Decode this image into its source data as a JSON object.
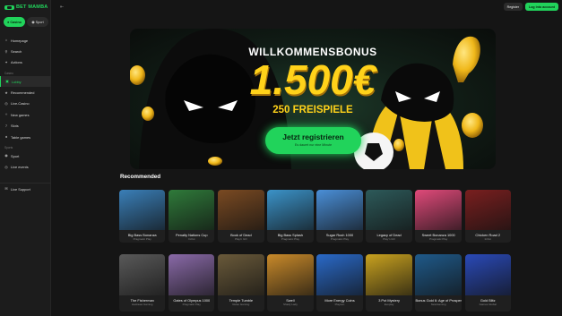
{
  "brand": {
    "name": "BET MAMBA",
    "accent": "#21d35b"
  },
  "sidebar": {
    "segments": [
      {
        "label": "Casino",
        "active": true
      },
      {
        "label": "Sport",
        "active": false
      }
    ],
    "top_items": [
      {
        "label": "Homepage",
        "icon": "home-icon"
      },
      {
        "label": "Search",
        "icon": "search-icon"
      },
      {
        "label": "Actions",
        "icon": "gift-icon"
      }
    ],
    "casino_label": "Casino",
    "casino_items": [
      {
        "label": "Lobby",
        "icon": "lobby-icon",
        "active": true
      },
      {
        "label": "Recommended",
        "icon": "star-icon"
      },
      {
        "label": "Live-Casino",
        "icon": "live-icon"
      },
      {
        "label": "New games",
        "icon": "new-icon"
      },
      {
        "label": "Slots",
        "icon": "slots-icon"
      },
      {
        "label": "Table games",
        "icon": "table-icon"
      }
    ],
    "sports_label": "Sports",
    "sports_items": [
      {
        "label": "Sport",
        "icon": "ball-icon"
      },
      {
        "label": "Live events",
        "icon": "live-events-icon"
      }
    ],
    "support": {
      "label": "Live Support",
      "icon": "chat-icon"
    }
  },
  "topbar": {
    "register": "Register",
    "login": "Log into account"
  },
  "hero": {
    "title": "WILLKOMMENSBONUS",
    "amount": "1.500€",
    "subtitle": "250 FREISPIELE",
    "cta": "Jetzt registrieren",
    "cta_sub": "Es dauert nur eine Minute"
  },
  "recommended": {
    "title": "Recommended",
    "row1": [
      {
        "name": "Big Bass Bonanza",
        "provider": "Pragmatic Play",
        "color": "#3a7fb8"
      },
      {
        "name": "Penalty Nations Cup",
        "provider": "InOut",
        "color": "#2f7a3a"
      },
      {
        "name": "Book of Dead",
        "provider": "Play'n GO",
        "color": "#7a4a22"
      },
      {
        "name": "Big Bass Splash",
        "provider": "Pragmatic Play",
        "color": "#3b93c9"
      },
      {
        "name": "Sugar Rush 1000",
        "provider": "Pragmatic Play",
        "color": "#4a8fd8"
      },
      {
        "name": "Legacy of Dead",
        "provider": "Play'n GO",
        "color": "#2d5a5a"
      },
      {
        "name": "Sweet Bonanza 1000",
        "provider": "Pragmatic Play",
        "color": "#e04a7a"
      },
      {
        "name": "Chicken Road 2",
        "provider": "InOut",
        "color": "#7a1f1f"
      }
    ],
    "row2": [
      {
        "name": "The Fisherman",
        "provider": "Hacksaw Gaming",
        "color": "#5a5a5a"
      },
      {
        "name": "Gates of Olympus 1000",
        "provider": "Pragmatic Play",
        "color": "#8a6aa8"
      },
      {
        "name": "Temple Tumble",
        "provider": "Relax Gaming",
        "color": "#6a5a3a"
      },
      {
        "name": "Swell",
        "provider": "Shady Lady",
        "color": "#c98a2a"
      },
      {
        "name": "More Energy Coins",
        "provider": "Playson",
        "color": "#2a6ac9"
      },
      {
        "name": "3 Pot Mystery",
        "provider": "Evoplay",
        "color": "#c9a21f"
      },
      {
        "name": "Bonus Gold 6: Age of Prosperity",
        "provider": "NetoGaming",
        "color": "#1f5a8a"
      },
      {
        "name": "Gold Blitz",
        "provider": "Games Global",
        "color": "#2a4ab8"
      }
    ]
  }
}
